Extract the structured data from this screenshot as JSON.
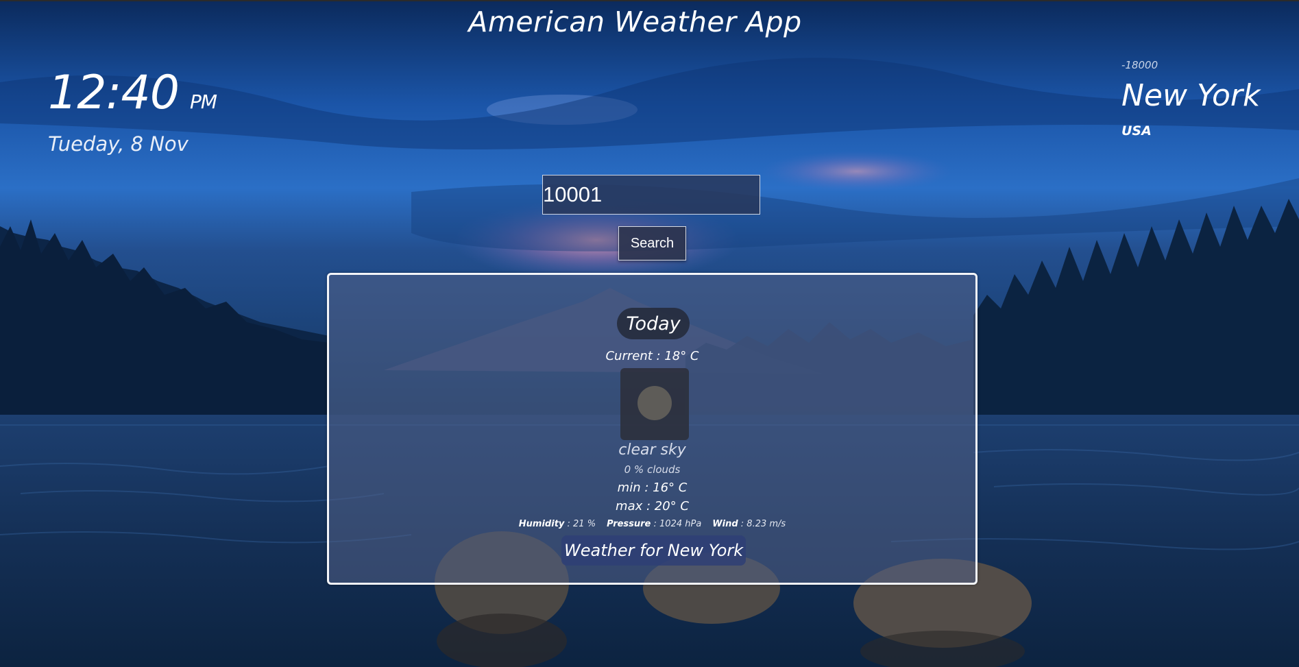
{
  "app": {
    "title": "American Weather App"
  },
  "clock": {
    "time": "12:40",
    "ampm": "PM",
    "date": "Tueday, 8 Nov"
  },
  "location": {
    "timezone": "-18000",
    "city": "New York",
    "country": "USA"
  },
  "search": {
    "value": "10001",
    "button_label": "Search"
  },
  "weather": {
    "heading": "Today",
    "current": "Current : 18° C",
    "icon": "clear-sky-icon",
    "description": "clear sky",
    "clouds": "0 % clouds",
    "min": "min : 16° C",
    "max": "max : 20° C",
    "humidity_label": "Humidity",
    "humidity_value": " : 21 %",
    "pressure_label": "Pressure",
    "pressure_value": " : 1024 hPa",
    "wind_label": "Wind",
    "wind_value": " : 8.23 m/s",
    "footer": "Weather for New York"
  },
  "colors": {
    "card_border": "#f3f5f9",
    "footer_pill": "#2e3e76"
  }
}
